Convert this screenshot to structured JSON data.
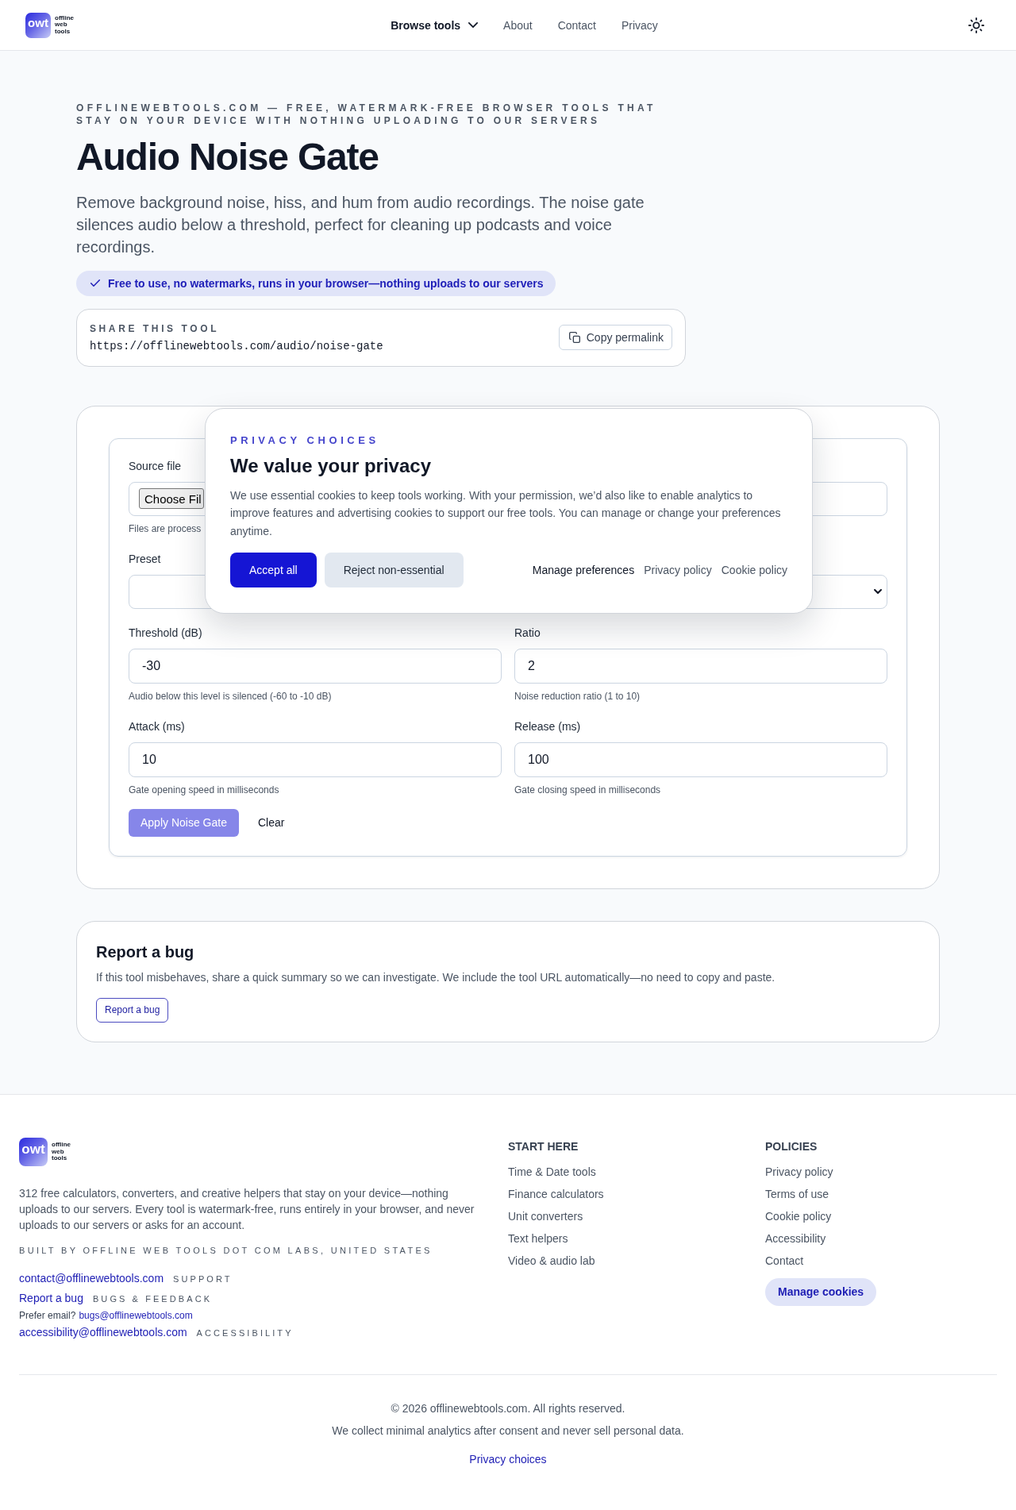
{
  "header": {
    "logo": {
      "mark": "owt",
      "name": "offline web tools"
    },
    "nav": [
      {
        "label": "Browse tools",
        "kind": "menu"
      },
      {
        "label": "About",
        "kind": "link"
      },
      {
        "label": "Contact",
        "kind": "link"
      },
      {
        "label": "Privacy",
        "kind": "link"
      }
    ]
  },
  "hero": {
    "eyebrow": "OFFLINEWEBTOOLS.COM — FREE, WATERMARK-FREE BROWSER TOOLS THAT STAY ON YOUR DEVICE WITH NOTHING UPLOADING TO OUR SERVERS",
    "title": "Audio Noise Gate",
    "description": "Remove background noise, hiss, and hum from audio recordings. The noise gate silences audio below a threshold, perfect for cleaning up podcasts and voice recordings.",
    "badge": "Free to use, no watermarks, runs in your browser—nothing uploads to our servers",
    "share": {
      "label": "SHARE THIS TOOL",
      "url": "https://offlinewebtools.com/audio/noise-gate",
      "button": "Copy permalink"
    }
  },
  "tool": {
    "fields": [
      {
        "kind": "file",
        "label": "Source file",
        "button": "Choose Fil",
        "hint": "Files are process"
      },
      {
        "kind": "select",
        "label": "Preset"
      },
      {
        "kind": "number",
        "label": "Threshold (dB)",
        "value": "-30",
        "hint": "Audio below this level is silenced (-60 to -10 dB)"
      },
      {
        "kind": "number",
        "label": "Ratio",
        "value": "2",
        "hint": "Noise reduction ratio (1 to 10)"
      },
      {
        "kind": "number",
        "label": "Attack (ms)",
        "value": "10",
        "hint": "Gate opening speed in milliseconds"
      },
      {
        "kind": "number",
        "label": "Release (ms)",
        "value": "100",
        "hint": "Gate closing speed in milliseconds"
      }
    ],
    "actions": [
      {
        "label": "Apply Noise Gate",
        "kind": "primary",
        "disabled": true
      },
      {
        "label": "Clear",
        "kind": "plain",
        "disabled": false
      }
    ]
  },
  "consent": {
    "eyebrow": "PRIVACY CHOICES",
    "title": "We value your privacy",
    "text": "We use essential cookies to keep tools working. With your permission, we’d also like to enable analytics to improve features and advertising cookies to support our free tools. You can manage or change your preferences anytime.",
    "buttons": [
      {
        "label": "Accept all",
        "kind": "primary"
      },
      {
        "label": "Reject non-essential",
        "kind": "secondary"
      }
    ],
    "links": [
      {
        "label": "Manage preferences",
        "kind": "action"
      },
      {
        "label": "Privacy policy",
        "kind": "link"
      },
      {
        "label": "Cookie policy",
        "kind": "link"
      }
    ]
  },
  "report": {
    "title": "Report a bug",
    "text": "If this tool misbehaves, share a quick summary so we can investigate. We include the tool URL automatically—no need to copy and paste.",
    "button": "Report a bug"
  },
  "footer": {
    "logo": {
      "mark": "owt",
      "name": "offline web tools"
    },
    "about": "312 free calculators, converters, and creative helpers that stay on your device—nothing uploads to our servers. Every tool is watermark-free, runs entirely in your browser, and never uploads to our servers or asks for an account.",
    "built_by": "BUILT BY OFFLINE WEB TOOLS DOT COM LABS, UNITED STATES",
    "contacts": [
      {
        "kind": "email",
        "link": "contact@offlinewebtools.com",
        "tag": "SUPPORT"
      },
      {
        "kind": "page",
        "link": "Report a bug",
        "tag": "BUGS & FEEDBACK"
      },
      {
        "kind": "note",
        "prefix": "Prefer email?",
        "link": "bugs@offlinewebtools.com"
      },
      {
        "kind": "email",
        "link": "accessibility@offlinewebtools.com",
        "tag": "ACCESSIBILITY"
      }
    ],
    "columns": [
      {
        "heading": "START HERE",
        "links": [
          "Time & Date tools",
          "Finance calculators",
          "Unit converters",
          "Text helpers",
          "Video & audio lab"
        ]
      },
      {
        "heading": "POLICIES",
        "links": [
          "Privacy policy",
          "Terms of use",
          "Cookie policy",
          "Accessibility",
          "Contact"
        ],
        "button": "Manage cookies"
      }
    ],
    "copyright": "© 2026 offlinewebtools.com. All rights reserved.",
    "notice": "We collect minimal analytics after consent and never sell personal data.",
    "privacy_link": "Privacy choices"
  }
}
